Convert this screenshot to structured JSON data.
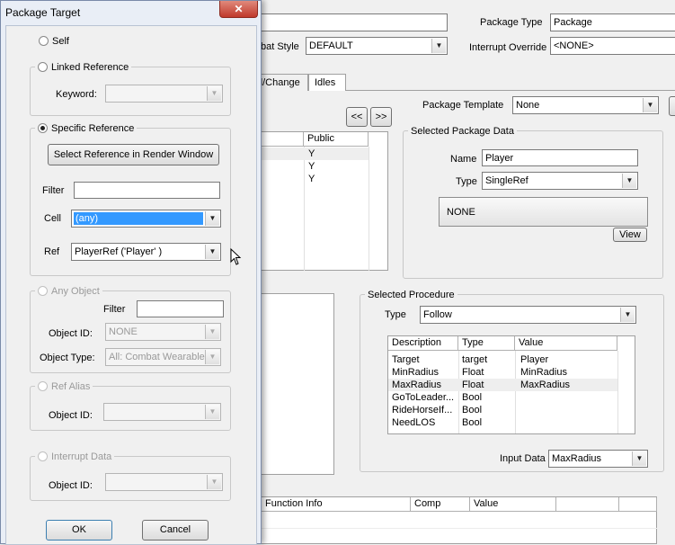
{
  "background_window": {
    "package_type": {
      "label": "Package Type",
      "value": "Package"
    },
    "combat_style": {
      "label": "bat Style",
      "value": "DEFAULT"
    },
    "interrupt_override": {
      "label": "Interrupt Override",
      "value": "<NONE>"
    },
    "tabs": [
      {
        "label": "d/Change"
      },
      {
        "label": "Idles"
      }
    ],
    "package_template": {
      "label": "Package Template",
      "value": "None"
    },
    "nav_prev": "<<",
    "nav_next": ">>",
    "data_list": {
      "header": "Public",
      "rows": [
        "Y",
        "Y",
        "Y"
      ]
    },
    "selected_package_data": {
      "title": "Selected Package Data",
      "name_label": "Name",
      "name_value": "Player",
      "type_label": "Type",
      "type_value": "SingleRef",
      "display_value": "NONE",
      "view_button": "View"
    },
    "selected_procedure": {
      "title": "Selected Procedure",
      "type_label": "Type",
      "type_value": "Follow",
      "columns": [
        "Description",
        "Type",
        "Value"
      ],
      "rows": [
        {
          "description": "Target",
          "type": "target",
          "value": "Player"
        },
        {
          "description": "MinRadius",
          "type": "Float",
          "value": "MinRadius"
        },
        {
          "description": "MaxRadius",
          "type": "Float",
          "value": "MaxRadius"
        },
        {
          "description": "GoToLeader...",
          "type": "Bool",
          "value": ""
        },
        {
          "description": "RideHorseIf...",
          "type": "Bool",
          "value": ""
        },
        {
          "description": "NeedLOS",
          "type": "Bool",
          "value": ""
        }
      ],
      "input_data_label": "Input Data",
      "input_data_value": "MaxRadius"
    },
    "conditions": {
      "columns": [
        "Function Info",
        "Comp",
        "Value"
      ]
    }
  },
  "dialog": {
    "title": "Package Target",
    "close_glyph": "✕",
    "self": {
      "label": "Self"
    },
    "linked_reference": {
      "label": "Linked Reference",
      "keyword_label": "Keyword:",
      "keyword_value": ""
    },
    "specific_reference": {
      "label": "Specific Reference",
      "select_button": "Select Reference in Render Window",
      "filter_label": "Filter",
      "filter_value": "",
      "cell_label": "Cell",
      "cell_value": "(any)",
      "ref_label": "Ref",
      "ref_value": "PlayerRef ('Player' )"
    },
    "any_object": {
      "label": "Any Object",
      "filter_label": "Filter",
      "filter_value": "",
      "object_id_label": "Object ID:",
      "object_id_value": "NONE",
      "object_type_label": "Object Type:",
      "object_type_value": "All: Combat Wearable"
    },
    "ref_alias": {
      "label": "Ref Alias",
      "object_id_label": "Object ID:",
      "object_id_value": ""
    },
    "interrupt_data": {
      "label": "Interrupt Data",
      "object_id_label": "Object ID:",
      "object_id_value": ""
    },
    "ok_button": "OK",
    "cancel_button": "Cancel"
  },
  "colors": {
    "selection": "#3399ff",
    "close_button": "#c75050",
    "dialog_frame": "#e9eef6"
  }
}
